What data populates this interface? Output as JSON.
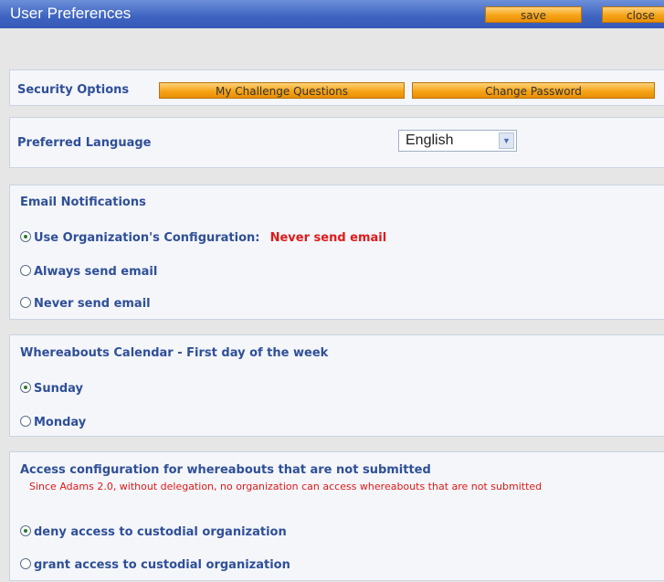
{
  "header": {
    "title": "User Preferences",
    "save_label": "save",
    "close_label": "close"
  },
  "security": {
    "label": "Security Options",
    "challenge_button": "My Challenge Questions",
    "password_button": "Change Password"
  },
  "language": {
    "label": "Preferred Language",
    "selected": "English"
  },
  "email": {
    "label": "Email Notifications",
    "options": [
      {
        "label": "Use Organization's Configuration:",
        "extra": "Never send email",
        "selected": true
      },
      {
        "label": "Always send email",
        "selected": false
      },
      {
        "label": "Never send email",
        "selected": false
      }
    ]
  },
  "calendar": {
    "label": "Whereabouts Calendar - First day of the week",
    "options": [
      {
        "label": "Sunday",
        "selected": true
      },
      {
        "label": "Monday",
        "selected": false
      }
    ]
  },
  "access": {
    "label": "Access configuration for whereabouts that are not submitted",
    "note": "Since Adams 2.0, without delegation, no organization can access whereabouts that are not submitted",
    "options": [
      {
        "label": "deny access to custodial organization",
        "selected": true
      },
      {
        "label": "grant access to custodial organization",
        "selected": false
      }
    ]
  },
  "colors": {
    "header_blue": "#3d63c0",
    "button_orange": "#f6a417",
    "label_blue": "#2f4f98",
    "alert_red": "#e01919"
  }
}
